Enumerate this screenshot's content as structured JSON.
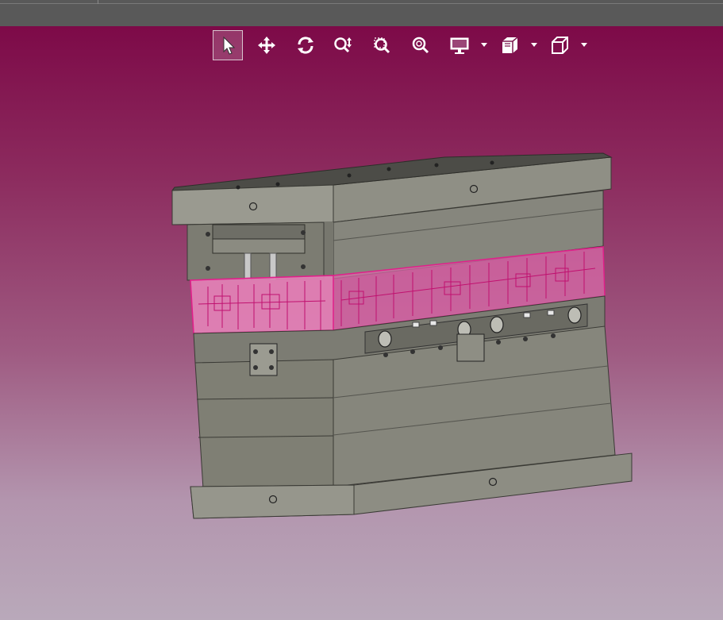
{
  "window": {
    "title": ""
  },
  "toolbar": {
    "tools": [
      {
        "id": "select",
        "icon": "select-cursor-icon",
        "active": true
      },
      {
        "id": "pan",
        "icon": "pan-move-icon",
        "active": false
      },
      {
        "id": "rotate",
        "icon": "rotate-icon",
        "active": false
      },
      {
        "id": "zoom-dynamic",
        "icon": "zoom-dynamic-icon",
        "active": false
      },
      {
        "id": "zoom-window",
        "icon": "zoom-window-icon",
        "active": false
      },
      {
        "id": "zoom-fit",
        "icon": "zoom-fit-icon",
        "active": false
      },
      {
        "id": "display-mode",
        "icon": "display-monitor-icon",
        "has_dropdown": true
      },
      {
        "id": "section-view",
        "icon": "section-view-icon",
        "has_dropdown": true
      },
      {
        "id": "view-orientation",
        "icon": "view-cube-icon",
        "has_dropdown": true
      }
    ]
  },
  "colors": {
    "viewport_top": "#7d0a48",
    "viewport_bottom": "#b9a9ba",
    "mold_steel": "#8a8a80",
    "mold_dark": "#6f6f66",
    "highlight": "#e0208a"
  },
  "model": {
    "name": "injection-mold-assembly",
    "highlighted_part": "cavity-insert-plate"
  }
}
